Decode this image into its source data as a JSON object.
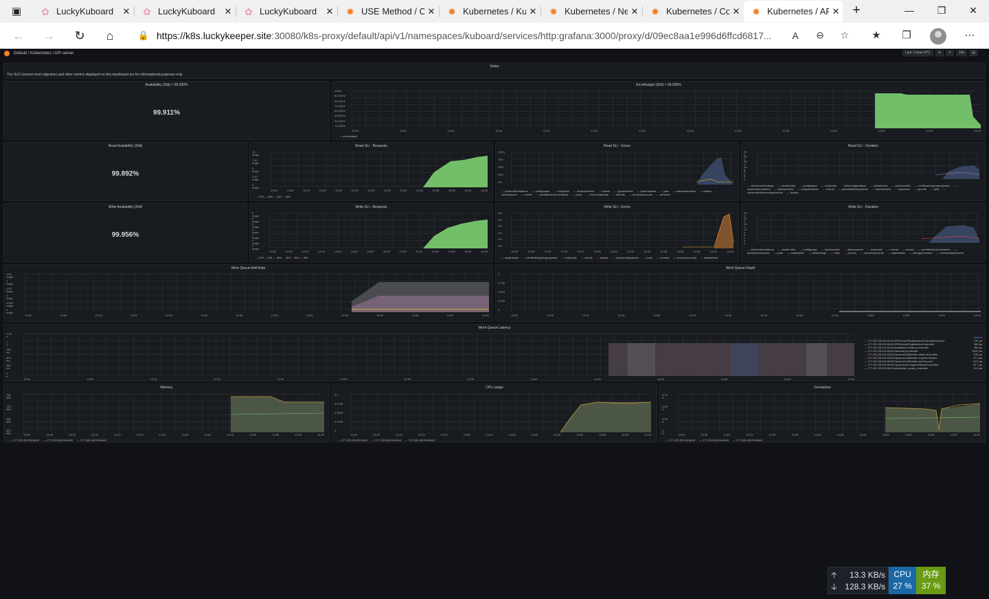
{
  "browser": {
    "tabs": [
      {
        "title": "LuckyKuboard",
        "icon": "flower-icon"
      },
      {
        "title": "LuckyKuboard",
        "icon": "flower-icon"
      },
      {
        "title": "LuckyKuboard",
        "icon": "flower-icon"
      },
      {
        "title": "USE Method / Cluster",
        "icon": "grafana-icon"
      },
      {
        "title": "Kubernetes / Kubelet",
        "icon": "grafana-icon"
      },
      {
        "title": "Kubernetes / Networking",
        "icon": "grafana-icon"
      },
      {
        "title": "Kubernetes / Compute",
        "icon": "grafana-icon"
      },
      {
        "title": "Kubernetes / API server",
        "icon": "grafana-icon"
      }
    ],
    "url_host": "https://k8s.luckykeeper.site",
    "url_rest": ":30080/k8s-proxy/default/api/v1/namespaces/kuboard/services/http:grafana:3000/proxy/d/09ec8aa1e996d6ffcd6817..."
  },
  "grafana": {
    "breadcrumb": "Default / Kubernetes / API server",
    "time_range": "Last 1 hour UTC",
    "refresh": "10s",
    "notes_title": "Notes",
    "notes_text": "The SLO (service level objective) and other metrics displayed on this dashboard are for informational purposes only.",
    "panels": {
      "availability": {
        "title": "Availability (30d) > 99.000%",
        "value": "99.911%"
      },
      "error_budget": {
        "title": "ErrorBudget (30d) > 99.000%",
        "legend": [
          "errorbudget"
        ],
        "yticks": [
          "100%",
          "90.000%",
          "80.000%",
          "70.000%",
          "60.000%",
          "50.000%",
          "40.000%",
          "70.000%"
        ]
      },
      "read_availability": {
        "title": "Read Availability (30d)",
        "value": "99.892%"
      },
      "read_requests": {
        "title": "Read SLI - Requests",
        "legend": [
          "200",
          "404",
          "410",
          "500"
        ],
        "yticks": [
          "10 reqps",
          "7.50 reqps",
          "5 reqps",
          "2.50 reqps",
          "0 reqps"
        ]
      },
      "read_errors": {
        "title": "Read SLI - Errors",
        "legend": [
          "clusterinformations",
          "configmaps",
          "endpoints",
          "endpointslices",
          "events",
          "ippamblocks",
          "ipamhandles",
          "jobs",
          "kubeadmtokens",
          "leases",
          "namespaces",
          "nodes",
          "persistentvolumeclaims",
          "pods",
          "resourcequotas",
          "secrets",
          "serviceaccounts",
          "services"
        ],
        "yticks": [
          "100%",
          "75%",
          "50%",
          "25%",
          "0%"
        ]
      },
      "read_duration": {
        "title": "Read SLI - Duration",
        "legend": [
          "clusterrolebindings",
          "clusterroles",
          "configmaps",
          "endpoints",
          "felixconfigurations",
          "ipamblocks",
          "ipamhandles",
          "certificatesigningrequests",
          "clusterinformations",
          "deployments",
          "endpointslices",
          "events",
          "globalnetworkpolicies",
          "daemonsets",
          "ingresses",
          "ippools",
          "jobs",
          "kubecontrollersconfigurations",
          "leases"
        ],
        "yticks": [
          "25 s",
          "20 s",
          "15 s",
          "10 s",
          "5 s",
          "0 s"
        ]
      },
      "write_availability": {
        "title": "Write Availability (30d)",
        "value": "99.956%"
      },
      "write_requests": {
        "title": "Write SLI - Requests",
        "legend": [
          "200",
          "201",
          "404",
          "409",
          "500",
          "504"
        ],
        "yticks": [
          "9 reqps",
          "8 reqps",
          "6 reqps",
          "4 reqps",
          "2 reqps",
          "1 reqps",
          "0 reqps"
        ]
      },
      "write_errors": {
        "title": "Write SLI - Errors",
        "legend": [
          "apiservices",
          "certificatesigningrequests",
          "endpoints",
          "events",
          "leases",
          "podsecuritypolicies",
          "pods",
          "secrets",
          "serviceaccounts",
          "statefulsets"
        ],
        "yticks": [
          "5%",
          "4%",
          "3%",
          "2%",
          "1%",
          "0%"
        ]
      },
      "write_duration": {
        "title": "Write SLI - Duration",
        "legend": [
          "clusterinformations",
          "clusterroles",
          "configmaps",
          "daemonsets",
          "deployments",
          "endpoints",
          "events",
          "leases",
          "persistentvolumeclaims",
          "persistentvolumes",
          "pods",
          "replicasets",
          "rolebindings",
          "roles",
          "secrets",
          "serviceaccounts",
          "statefulsets",
          "storageversions",
          "volumeattachments"
        ],
        "yticks": [
          "25 s",
          "20 s",
          "15 s",
          "10 s",
          "5 s",
          "0 s"
        ]
      },
      "wq_add_rate": {
        "title": "Work Queue Add Rate",
        "yticks": [
          "2.50 reqps",
          "2 reqps",
          "1.50 reqps",
          "1 reqps",
          "0.500 reqps",
          "0 reqps"
        ]
      },
      "wq_depth": {
        "title": "Work Queue Depth",
        "yticks": [
          "1",
          "0.750",
          "0.500",
          "0.250",
          "0"
        ]
      },
      "wq_latency": {
        "title": "Work Queue Latency",
        "yticks": [
          "1.25 s",
          "1 s",
          "750 ms",
          "500 ms",
          "250 ms",
          "0 s"
        ],
        "legend_header": "current",
        "legend": [
          {
            "name": "177.220.28.201:6443 APIServiceRegistrationController/Queue1",
            "value": "750 µs"
          },
          {
            "name": "177.220.28.201:6443 APIServiceRegistrationController",
            "value": "380 µs"
          },
          {
            "name": "177.220.28.201:6443 AvailableConditionController",
            "value": "380 µs"
          },
          {
            "name": "177.220.28.201:6443 DiscoveryController",
            "value": "8.00 ms"
          },
          {
            "name": "177.220.28.201:6443 DynamicCABundle-client-ca-bundle",
            "value": "910 µs"
          },
          {
            "name": "177.220.28.201:6443 DynamicCABundle-request-header",
            "value": "17.0 µs"
          },
          {
            "name": "177.220.28.201:6443 DynamicCABundle-serving-cert",
            "value": "3.07 µs"
          },
          {
            "name": "177.220.28.201:6443 DynamicServingCertificateController",
            "value": "19.7 µs"
          },
          {
            "name": "177.220.28.201:6443 admission_quota_controller",
            "value": "11.6 µs"
          }
        ]
      },
      "memory": {
        "title": "Memory",
        "legend": [
          "177.220.28.201:6443",
          "177.220.28.202:6443",
          "177.220.28.203:6443"
        ],
        "yticks": [
          "750 MiB",
          "700 MiB",
          "650 MiB",
          "600 MiB"
        ]
      },
      "cpu": {
        "title": "CPU usage",
        "legend": [
          "177.220.28.201:6443",
          "177.220.28.202:6443",
          "177.220.28.203:6443"
        ],
        "yticks": [
          "0.1",
          "0.0750",
          "0.0500",
          "0.0250",
          "0"
        ]
      },
      "goroutines": {
        "title": "Goroutines",
        "legend": [
          "177.220.28.201:6443",
          "177.220.28.202:6443",
          "177.220.28.203:6443"
        ],
        "yticks": [
          "3.75 K",
          "3.50 K",
          "3.25 K",
          "3 K"
        ]
      }
    },
    "xticks": [
      "13:00",
      "13:05",
      "13:10",
      "13:15",
      "13:20",
      "13:25",
      "13:30",
      "13:35",
      "13:40",
      "13:45",
      "13:50",
      "13:55",
      "14:00",
      "14:05"
    ]
  },
  "netmonitor": {
    "up": "13.3 KB/s",
    "down": "128.3 KB/s",
    "cpu_label": "CPU",
    "cpu_value": "27 %",
    "mem_label": "内存",
    "mem_value": "37 %"
  },
  "colors": {
    "green": "#73bf69",
    "grafana_bg": "#111217",
    "panel_bg": "#181b1f",
    "cpu_badge": "#1c68a6",
    "mem_badge": "#6a9a13"
  }
}
